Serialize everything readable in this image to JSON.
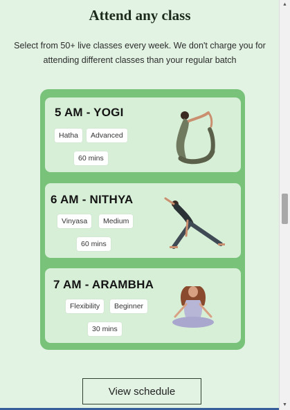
{
  "section": {
    "title": "Attend any class",
    "subtitle": "Select from 50+ live classes every week. We don't charge you for attending different classes than your regular batch"
  },
  "classes": [
    {
      "title": "5 AM - YOGI",
      "tags": [
        "Hatha",
        "Advanced"
      ],
      "duration": "60 mins",
      "illustration": "yoga-backbend-pose-icon"
    },
    {
      "title": "6 AM - NITHYA",
      "tags": [
        "Vinyasa",
        "Medium"
      ],
      "duration": "60 mins",
      "illustration": "yoga-triangle-pose-icon"
    },
    {
      "title": "7 AM - ARAMBHA",
      "tags": [
        "Flexibility",
        "Beginner"
      ],
      "duration": "30 mins",
      "illustration": "yoga-lotus-meditation-icon"
    }
  ],
  "cta": {
    "label": "View schedule"
  },
  "colors": {
    "page_bg": "#e2f3e3",
    "panel_green": "#78c27a",
    "card_bg": "#d7eed7",
    "chip_bg": "#ffffff"
  },
  "scrollbar": {
    "up_icon": "scroll-up-arrow-icon",
    "down_icon": "scroll-down-arrow-icon"
  }
}
